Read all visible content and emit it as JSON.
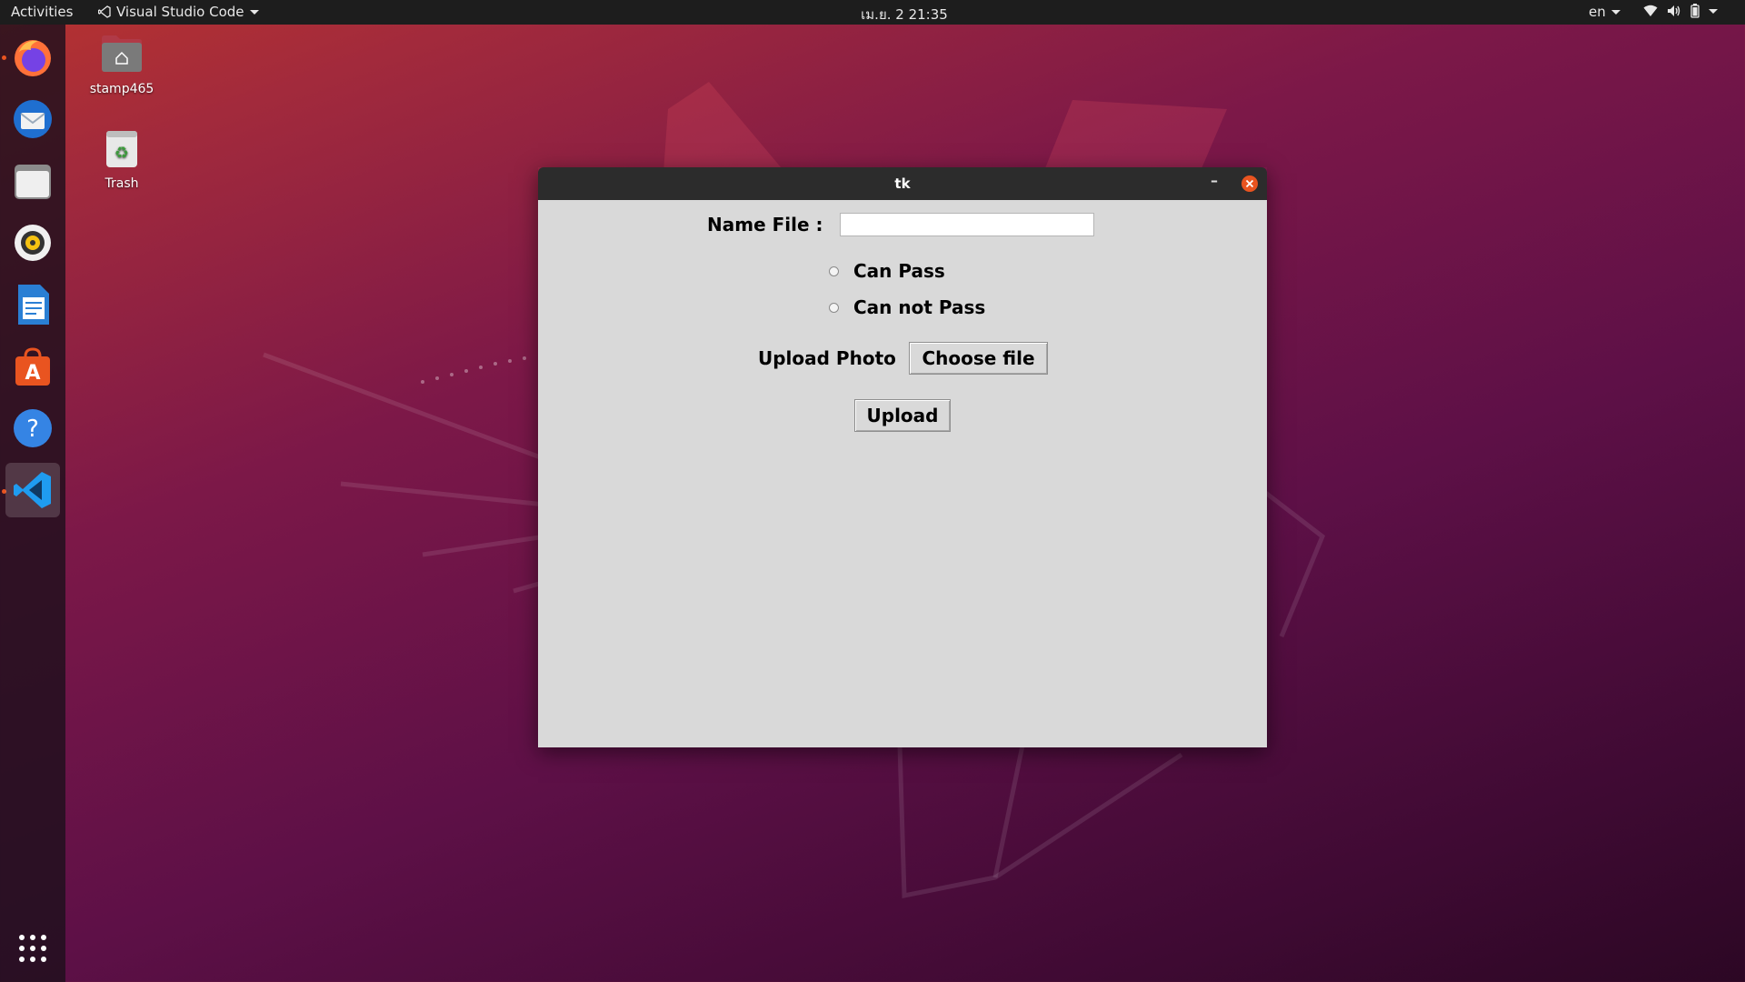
{
  "topbar": {
    "activities": "Activities",
    "app_name": "Visual Studio Code",
    "clock": "เม.ย. 2  21:35",
    "language": "en"
  },
  "dock": {
    "items": [
      {
        "name": "Firefox",
        "icon": "firefox-icon",
        "running": true
      },
      {
        "name": "Thunderbird",
        "icon": "thunderbird-icon",
        "running": false
      },
      {
        "name": "Files",
        "icon": "files-icon",
        "running": false
      },
      {
        "name": "Rhythmbox",
        "icon": "rhythmbox-icon",
        "running": false
      },
      {
        "name": "LibreOffice Writer",
        "icon": "writer-icon",
        "running": false
      },
      {
        "name": "Ubuntu Software",
        "icon": "software-icon",
        "running": false
      },
      {
        "name": "Help",
        "icon": "help-icon",
        "running": false
      },
      {
        "name": "Visual Studio Code",
        "icon": "vscode-icon",
        "running": true,
        "active": true
      }
    ],
    "show_apps": "show-applications-icon"
  },
  "desktop": {
    "home_label": "stamp465",
    "trash_label": "Trash"
  },
  "window": {
    "title": "tk",
    "name_file_label": "Name File :",
    "name_file_value": "",
    "radio_1": "Can Pass",
    "radio_2": "Can not Pass",
    "upload_photo_label": "Upload Photo",
    "choose_file_button": "Choose file",
    "upload_button": "Upload"
  },
  "colors": {
    "accent": "#e95420",
    "titlebar": "#2c2c2c",
    "client_bg": "#d9d9d9"
  }
}
